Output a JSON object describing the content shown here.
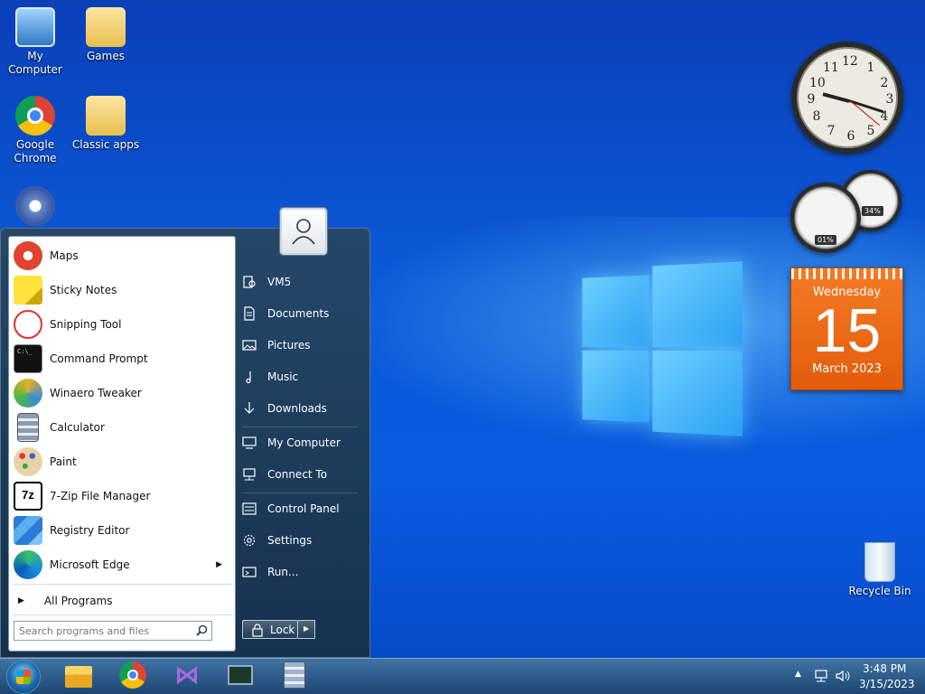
{
  "desktop": {
    "icons": [
      {
        "label": "My Computer"
      },
      {
        "label": "Games"
      },
      {
        "label": "Google Chrome"
      },
      {
        "label": "Classic apps"
      },
      {
        "label": "Recycle Bin"
      }
    ]
  },
  "gadgets": {
    "clock": {
      "numerals": [
        "12",
        "1",
        "2",
        "3",
        "4",
        "5",
        "6",
        "7",
        "8",
        "9",
        "10",
        "11"
      ]
    },
    "cpu_meter": {
      "cpu": "01%",
      "memory": "34%"
    },
    "calendar": {
      "weekday": "Wednesday",
      "day": "15",
      "month_year": "March 2023"
    }
  },
  "start_menu": {
    "programs": [
      {
        "label": "Maps",
        "icon": "maps-icon"
      },
      {
        "label": "Sticky Notes",
        "icon": "sticky-notes-icon"
      },
      {
        "label": "Snipping Tool",
        "icon": "scissors-icon"
      },
      {
        "label": "Command Prompt",
        "icon": "terminal-icon"
      },
      {
        "label": "Winaero Tweaker",
        "icon": "tweaker-icon"
      },
      {
        "label": "Calculator",
        "icon": "calculator-icon"
      },
      {
        "label": "Paint",
        "icon": "palette-icon"
      },
      {
        "label": "7-Zip File Manager",
        "icon": "7zip-icon"
      },
      {
        "label": "Registry Editor",
        "icon": "registry-icon"
      },
      {
        "label": "Microsoft Edge",
        "icon": "edge-icon"
      }
    ],
    "all_programs": "All Programs",
    "search_placeholder": "Search programs and files",
    "right_items": [
      {
        "label": "VM5"
      },
      {
        "label": "Documents"
      },
      {
        "label": "Pictures"
      },
      {
        "label": "Music"
      },
      {
        "label": "Downloads"
      },
      {
        "label": "My Computer"
      },
      {
        "label": "Connect To"
      },
      {
        "label": "Control Panel"
      },
      {
        "label": "Settings"
      },
      {
        "label": "Run..."
      }
    ],
    "lock_label": "Lock"
  },
  "taskbar": {
    "pinned": [
      "file-explorer-icon",
      "chrome-icon",
      "visual-studio-icon",
      "task-manager-icon",
      "calculator-icon"
    ],
    "time": "3:48 PM",
    "date": "3/15/2023"
  },
  "colors": {
    "accent": "#0a5be0",
    "calendar": "#f47a24"
  }
}
